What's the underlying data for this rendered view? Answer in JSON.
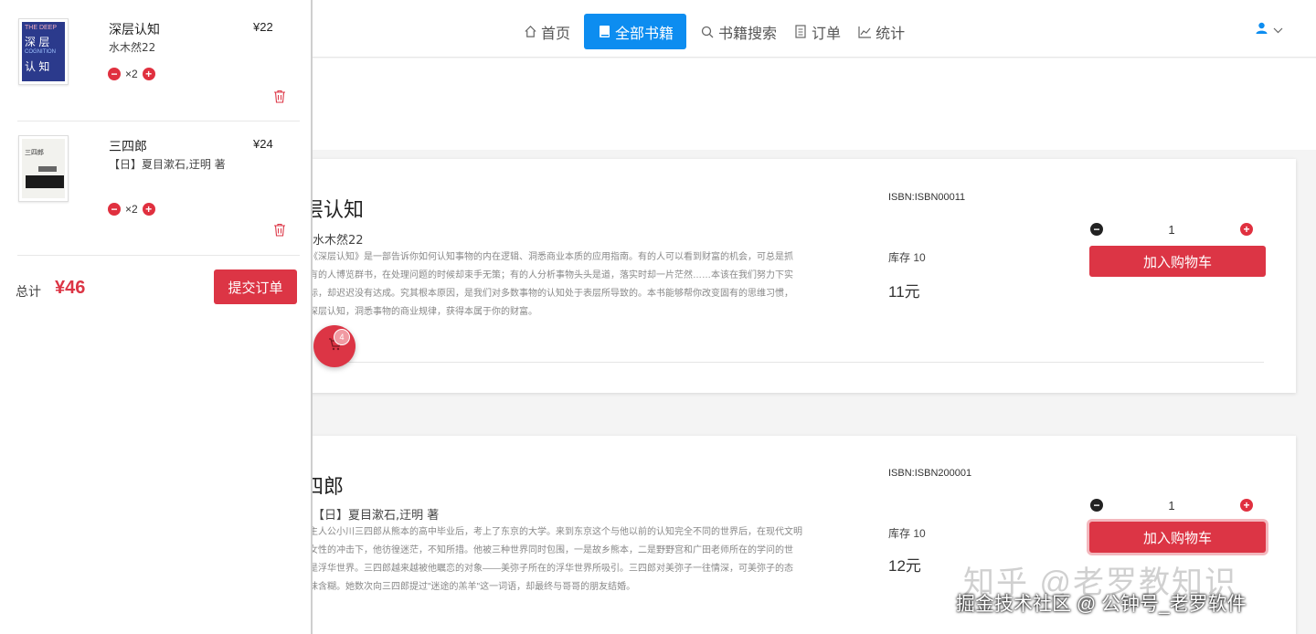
{
  "nav": {
    "items": [
      {
        "label": "首页",
        "icon": "home-icon"
      },
      {
        "label": "全部书籍",
        "icon": "book-icon",
        "active": true
      },
      {
        "label": "书籍搜索",
        "icon": "search-icon"
      },
      {
        "label": "订单",
        "icon": "order-icon"
      },
      {
        "label": "统计",
        "icon": "chart-icon"
      }
    ],
    "user_icon": "user-icon"
  },
  "books": [
    {
      "title": "层认知",
      "author": "水木然22",
      "desc": [
        "《深层认知》是一部告诉你如何认知事物的内在逻辑、洞悉商业本质的应用指南。有的人可以看到财富的机会，可总是抓",
        "有的人博览群书，在处理问题的时候却束手无策；有的人分析事物头头是道，落实时却一片茫然……本该在我们努力下实",
        "标，却迟迟没有达成。究其根本原因，是我们对多数事物的认知处于表层所导致的。本书能够帮你改变固有的思维习惯，",
        "深层认知，洞悉事物的商业规律，获得本属于你的财富。"
      ],
      "isbn": "ISBN:ISBN00011",
      "stock": "库存 10",
      "price": "11元",
      "qty": "1",
      "add_label": "加入购物车"
    },
    {
      "title": "四郎",
      "author": "【日】夏目漱石,迂明 著",
      "desc": [
        "主人公小川三四郎从熊本的高中毕业后，考上了东京的大学。来到东京这个与他以前的认知完全不同的世界后，在现代文明",
        "女性的冲击下，他彷徨迷茫，不知所措。他被三种世界同时包围，一是故乡熊本，二是野野宫和广田老师所在的学问的世",
        "是浮华世界。三四郎越来越被他瞩恋的对象——美弥子所在的浮华世界所吸引。三四郎对美弥子一往情深，可美弥子的态",
        "昧含糊。她数次向三四郎提过\"迷途的羔羊\"这一词语，却最终与哥哥的朋友结婚。"
      ],
      "isbn": "ISBN:ISBN200001",
      "stock": "库存 10",
      "price": "12元",
      "qty": "1",
      "add_label": "加入购物车"
    }
  ],
  "cart_fab": {
    "count": "4",
    "icon": "cart-icon"
  },
  "cart": {
    "items": [
      {
        "title": "深层认知",
        "author": "水木然22",
        "price": "¥22",
        "qty": "×2",
        "cover_text": [
          "THE DEEP",
          "深 层",
          "COGNITION",
          "认 知"
        ]
      },
      {
        "title": "三四郎",
        "author": "【日】夏目漱石,迂明 著",
        "price": "¥24",
        "qty": "×2",
        "cover_text": [
          "三四郎"
        ]
      }
    ],
    "total_label": "总计",
    "total_value": "¥46",
    "submit_label": "提交订单"
  },
  "watermark": {
    "line1": "知乎 @老罗教知识",
    "line2": "掘金技术社区 @ 公钟号_老罗软件"
  },
  "colors": {
    "primary": "#0d8df0",
    "danger": "#dc3545"
  }
}
